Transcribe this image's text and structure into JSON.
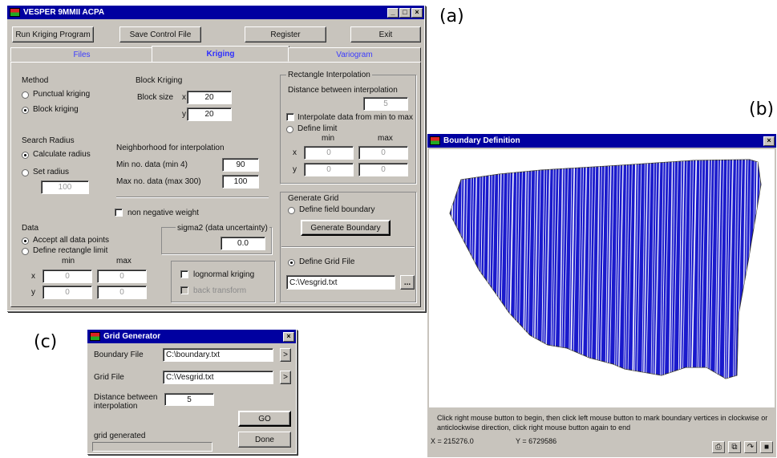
{
  "figure_labels": {
    "a": "(a)",
    "b": "(b)",
    "c": "(c)"
  },
  "main_window": {
    "title": "VESPER 9MMII ACPA",
    "title_buttons": [
      "_",
      "□",
      "×"
    ],
    "toolbar": {
      "run": "Run Kriging Program",
      "save": "Save Control File",
      "register": "Register",
      "exit": "Exit"
    },
    "tabs": [
      {
        "label": "Files",
        "active": false
      },
      {
        "label": "Kriging",
        "active": true
      },
      {
        "label": "Variogram",
        "active": false
      }
    ],
    "method": {
      "heading": "Method",
      "options": [
        {
          "label": "Punctual kriging",
          "selected": false
        },
        {
          "label": "Block kriging",
          "selected": true
        }
      ]
    },
    "block_kriging": {
      "heading": "Block Kriging",
      "size_label": "Block size",
      "x_label": "x",
      "x_value": "20",
      "y_label": "y",
      "y_value": "20"
    },
    "search_radius": {
      "heading": "Search Radius",
      "options": [
        {
          "label": "Calculate radius",
          "selected": true
        },
        {
          "label": "Set radius",
          "selected": false
        }
      ],
      "radius_value": "100"
    },
    "neighborhood": {
      "heading": "Neighborhood for interpolation",
      "min_label": "Min no. data (min 4)",
      "min_value": "90",
      "max_label": "Max no. data (max 300)",
      "max_value": "100"
    },
    "non_negative": "non negative weight",
    "data": {
      "heading": "Data",
      "options": [
        {
          "label": "Accept all data points",
          "selected": true
        },
        {
          "label": "Define rectangle limit",
          "selected": false
        }
      ],
      "min_label": "min",
      "max_label": "max",
      "x_label": "x",
      "y_label": "y",
      "x_min": "0",
      "x_max": "0",
      "y_min": "0",
      "y_max": "0"
    },
    "sigma": {
      "label": "sigma2 (data uncertainty)",
      "value": "0.0"
    },
    "lognormal": "lognormal kriging",
    "disabled_check": "back transform",
    "rectangle_interp": {
      "heading": "Rectangle Interpolation",
      "distance_label": "Distance between interpolation",
      "distance_value": "5",
      "options": [
        {
          "label": "Interpolate data from min to max",
          "selected": false
        },
        {
          "label": "Define limit",
          "selected": false
        }
      ],
      "min_label": "min",
      "max_label": "max",
      "x_label": "x",
      "y_label": "y",
      "x_min": "0",
      "x_max": "0",
      "y_min": "0",
      "y_max": "0"
    },
    "generate_grid": {
      "heading": "Generate Grid",
      "option": "Define field boundary",
      "button": "Generate Boundary"
    },
    "grid_file": {
      "option": "Define Grid File",
      "path": "C:\\Vesgrid.txt",
      "browse": "..."
    }
  },
  "boundary_window": {
    "title": "Boundary Definition",
    "close": "×",
    "fill_color": "#1a1acc",
    "instructions": "Click right mouse button to begin, then click left mouse button to mark boundary vertices in clockwise or anticlockwise direction, click right mouse button again to end",
    "x_coord": "X = 215276.0",
    "y_coord": "Y = 6729586"
  },
  "grid_window": {
    "title": "Grid Generator",
    "close": "×",
    "boundary_label": "Boundary File",
    "boundary_value": "C:\\boundary.txt",
    "grid_label": "Grid File",
    "grid_value": "C:\\Vesgrid.txt",
    "browse": ">",
    "distance_label_1": "Distance between",
    "distance_label_2": "interpolation",
    "distance_value": "5",
    "go": "GO",
    "status": "grid generated",
    "done": "Done"
  }
}
